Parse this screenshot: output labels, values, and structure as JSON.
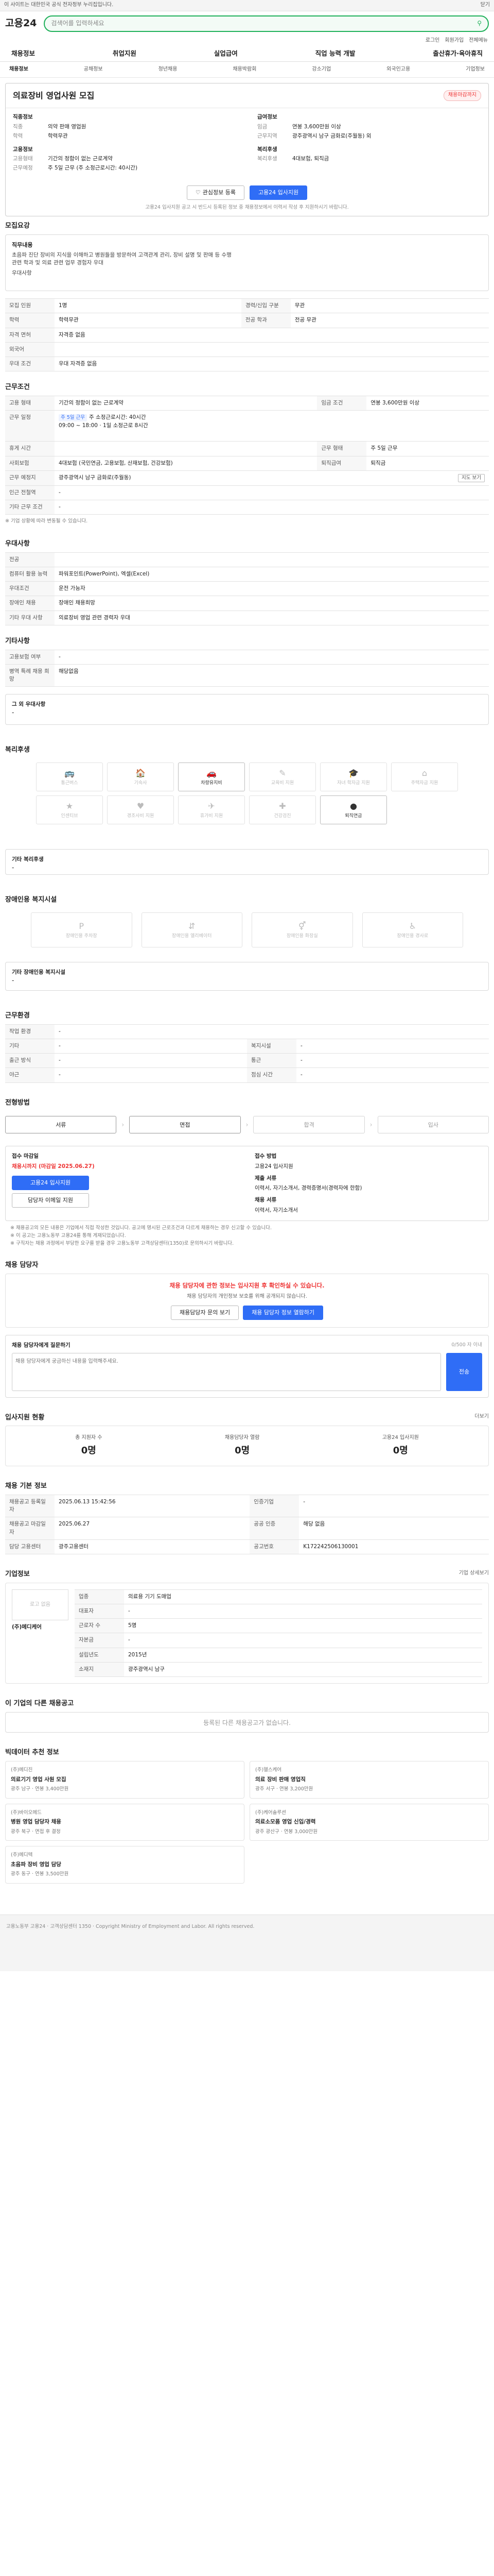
{
  "topbar": {
    "text": "이 사이트는 대한민국 공식 전자정부 누리집입니다.",
    "close": "닫기"
  },
  "header": {
    "logo": "고용24",
    "search_placeholder": "검색어를 입력하세요",
    "util": [
      "로그인",
      "회원가입",
      "전체메뉴"
    ]
  },
  "gnb": [
    "채용정보",
    "취업지원",
    "실업급여",
    "직업 능력 개발",
    "출산휴가·육아휴직"
  ],
  "subnav": [
    "채용정보",
    "공채정보",
    "청년채용",
    "채용박람회",
    "강소기업",
    "외국인고용",
    "기업정보"
  ],
  "job": {
    "title": "의료장비 영업사원 모집",
    "dday": "채용마감까지",
    "left": [
      {
        "k": "직종정보",
        "v": "",
        "head": true
      },
      {
        "k": "직종",
        "v": "의약 판매 영업원"
      },
      {
        "k": "학력",
        "v": "학력무관"
      },
      {
        "k": "",
        "v": ""
      },
      {
        "k": "고용정보",
        "v": "",
        "head": true
      },
      {
        "k": "고용형태",
        "v": "기간의 정함이 없는 근로계약"
      },
      {
        "k": "근무예정",
        "v": "주 5일 근무 (주 소정근로시간: 40시간)"
      }
    ],
    "right": [
      {
        "k": "급여정보",
        "v": "",
        "head": true
      },
      {
        "k": "임금",
        "v": "연봉 3,600만원 이상"
      },
      {
        "k": "근무지역",
        "v": "광주광역시 남구 금화로(주월동) 외"
      },
      {
        "k": "",
        "v": ""
      },
      {
        "k": "복리후생",
        "v": "",
        "head": true
      },
      {
        "k": "복리후생",
        "v": "4대보험, 퇴직금"
      }
    ],
    "btn_interest": "관심정보 등록",
    "btn_apply": "고용24 입사지원",
    "note": "고용24 입사지원 공고 시 반드시 등록된 정보 중 채용정보에서 이력서 작성 후 지원하시기 바랍니다."
  },
  "duty": {
    "title": "모집요강",
    "label": "직무내용",
    "text": "초음파 진단 장비의 지식을 이해하고 병원들을 방문하여 고객관계 관리, 장비 설명 및 판매 등 수행\n관련 학과 및 의료 관련 업무 경험자 우대",
    "req": "우대사항"
  },
  "recruit": {
    "rows": [
      [
        "모집 인원",
        "1명",
        "경력/신입 구분",
        "무관"
      ],
      [
        "학력",
        "학력무관",
        "전공 학과",
        "전공 무관"
      ],
      [
        "자격 면허",
        "자격증 없음",
        "",
        ""
      ],
      [
        "외국어",
        "",
        "",
        ""
      ],
      [
        "우대 조건",
        "우대 자격증 없음",
        "",
        ""
      ]
    ]
  },
  "work": {
    "title": "근무조건",
    "type": "기간의 정함이 없는 근로계약",
    "wage": "연봉 3,600만원 이상",
    "schedule_tag": "주 5일 근무",
    "schedule": "주 소정근로시간: 40시간",
    "time": "09:00 ~ 18:00",
    "hours": "1일 소정근로 8시간",
    "transfer": "",
    "welfare": "4대보험 (국민연금, 고용보험, 산재보험, 건강보험)",
    "retire": "퇴직금",
    "place": "광주광역시 남구 금화로(주월동)",
    "map": "지도 보기",
    "memo": "※ 기업 상황에 따라 변동될 수 있습니다."
  },
  "extra": {
    "title": "우대사항",
    "rows": [
      [
        "전공",
        ""
      ],
      [
        "컴퓨터 활용 능력",
        "파워포인트(PowerPoint), 엑셀(Excel)"
      ],
      [
        "우대조건",
        "운전 가능자"
      ],
      [
        "장애인 채용",
        "장애인 채용희망"
      ],
      [
        "기타 우대 사항",
        "의료장비 영업 관련 경력자 우대"
      ]
    ]
  },
  "etc": {
    "title": "기타사항",
    "rows": [
      [
        "고용보험 여부",
        "-"
      ],
      [
        "병역 특례 채용 희망",
        "해당없음"
      ]
    ],
    "other_label": "그 외 우대사항",
    "other": "-"
  },
  "welfare": {
    "title": "복리후생",
    "items": [
      {
        "label": "통근버스",
        "icon": "bus-icon",
        "on": false
      },
      {
        "label": "기숙사",
        "icon": "dorm-icon",
        "on": false
      },
      {
        "label": "차량유지비",
        "icon": "car-icon",
        "on": true
      },
      {
        "label": "교육비 지원",
        "icon": "edu-icon",
        "on": false
      },
      {
        "label": "자녀 학자금 지원",
        "icon": "grad-icon",
        "on": false
      },
      {
        "label": "주택자금 지원",
        "icon": "house-icon",
        "on": false
      },
      {
        "label": "인센티브",
        "icon": "money-icon",
        "on": false
      },
      {
        "label": "경조사비 지원",
        "icon": "gift-icon",
        "on": false
      },
      {
        "label": "휴가비 지원",
        "icon": "travel-icon",
        "on": false
      },
      {
        "label": "건강검진",
        "icon": "health-icon",
        "on": false
      },
      {
        "label": "퇴직연금",
        "icon": "pension-icon",
        "on": true
      }
    ],
    "other_label": "기타 복리후생",
    "other": "-"
  },
  "disab": {
    "title": "장애인용 복지시설",
    "items": [
      {
        "label": "장애인용 주차장"
      },
      {
        "label": "장애인용 엘리베이터"
      },
      {
        "label": "장애인용 화장실"
      },
      {
        "label": "장애인용 경사로"
      }
    ],
    "other_label": "기타 장애인용 복지시설",
    "other": "-"
  },
  "workplace": {
    "title": "근무환경",
    "rows": [
      [
        "작업 환경",
        "-",
        "",
        ""
      ],
      [
        "기타",
        "-",
        "복지시설",
        "-"
      ],
      [
        "출근 방식",
        "-",
        "통근",
        "-"
      ],
      [
        "야근",
        "-",
        "점심 시간",
        "-"
      ]
    ]
  },
  "process": {
    "title": "전형방법",
    "steps": [
      "서류",
      "면접",
      "합격",
      "입사"
    ]
  },
  "apply": {
    "label1": "접수 마감일",
    "deadline": "채용시까지 (마감일 2025.06.27)",
    "method_label": "접수 방법",
    "method": "고용24 입사지원",
    "btn1": "고용24 입사지원",
    "btn2": "담당자 이메일 지원",
    "label2": "제출 서류",
    "docs": "이력서, 자기소개서, 경력증명서(경력자에 한함)",
    "label3": "채용 서류",
    "docs2": "이력서, 자기소개서"
  },
  "bullets": [
    "※ 채용공고의 모든 내용은 기업에서 직접 작성한 것입니다. 공고에 명시된 근로조건과 다르게 채용하는 경우 신고할 수 있습니다.",
    "※ 이 공고는 고용노동부 고용24를 통해 게재되었습니다.",
    "※ 구직자는 채용 과정에서 부당한 요구를 받을 경우 고용노동부 고객상담센터(1350)로 문의하시기 바랍니다."
  ],
  "contact": {
    "title": "채용 담당자",
    "call_title": "채용 담당자에 관한 정보는 입사지원 후 확인하실 수 있습니다.",
    "call_text": "채용 담당자의 개인정보 보호를 위해 공개되지 않습니다.",
    "btn1": "채용담당자 문의 보기",
    "btn2": "채용 담당자 정보 열람하기",
    "qna_label": "채용 담당자에게 질문하기",
    "qna_hint": "0/500 자 이내",
    "placeholder": "채용 담당자에게 궁금하신 내용을 입력해주세요.",
    "submit": "전송"
  },
  "stats": {
    "title": "입사지원 현황",
    "more": "더보기",
    "items": [
      {
        "k": "총 지원자 수",
        "v": "0명"
      },
      {
        "k": "채용담당자 열람",
        "v": "0명"
      },
      {
        "k": "고용24 입사지원",
        "v": "0명"
      }
    ]
  },
  "info": {
    "title": "채용 기본 정보",
    "rows": [
      [
        "채용공고 등록일자",
        "2025.06.13 15:42:56",
        "인증기업",
        "-"
      ],
      [
        "채용공고 마감일자",
        "2025.06.27",
        "공공 인증",
        "해당 없음"
      ],
      [
        "담당 고용센터",
        "광주고용센터",
        "공고번호",
        "K172242506130001"
      ]
    ]
  },
  "companyinfo": {
    "title": "기업정보",
    "more": "기업 상세보기",
    "name": "(주)메디케어",
    "logo": "로고 없음",
    "rows": [
      [
        "업종",
        "의료용 기기 도매업"
      ],
      [
        "대표자",
        "-"
      ],
      [
        "근로자 수",
        "5명"
      ],
      [
        "자본금",
        "-"
      ],
      [
        "설립년도",
        "2015년"
      ],
      [
        "소재지",
        "광주광역시 남구"
      ]
    ]
  },
  "recommend": {
    "title": "이 기업의 다른 채용공고",
    "empty": "등록된 다른 채용공고가 없습니다.",
    "title2": "빅데이터 추천 정보",
    "cards": [
      {
        "co": "(주)메디진",
        "title": "의료기기 영업 사원 모집",
        "meta": "광주 남구 · 연봉 3,400만원"
      },
      {
        "co": "(주)헬스케어",
        "title": "의료 장비 판매 영업직",
        "meta": "광주 서구 · 연봉 3,200만원"
      },
      {
        "co": "(주)바이오메드",
        "title": "병원 영업 담당자 채용",
        "meta": "광주 북구 · 면접 후 결정"
      },
      {
        "co": "(주)케어솔루션",
        "title": "의료소모품 영업 신입/경력",
        "meta": "광주 광산구 · 연봉 3,000만원"
      },
      {
        "co": "(주)메디텍",
        "title": "초음파 장비 영업 담당",
        "meta": "광주 동구 · 연봉 3,500만원"
      }
    ]
  },
  "footer": "고용노동부 고용24 · 고객상담센터 1350 · Copyright Ministry of Employment and Labor. All rights reserved."
}
